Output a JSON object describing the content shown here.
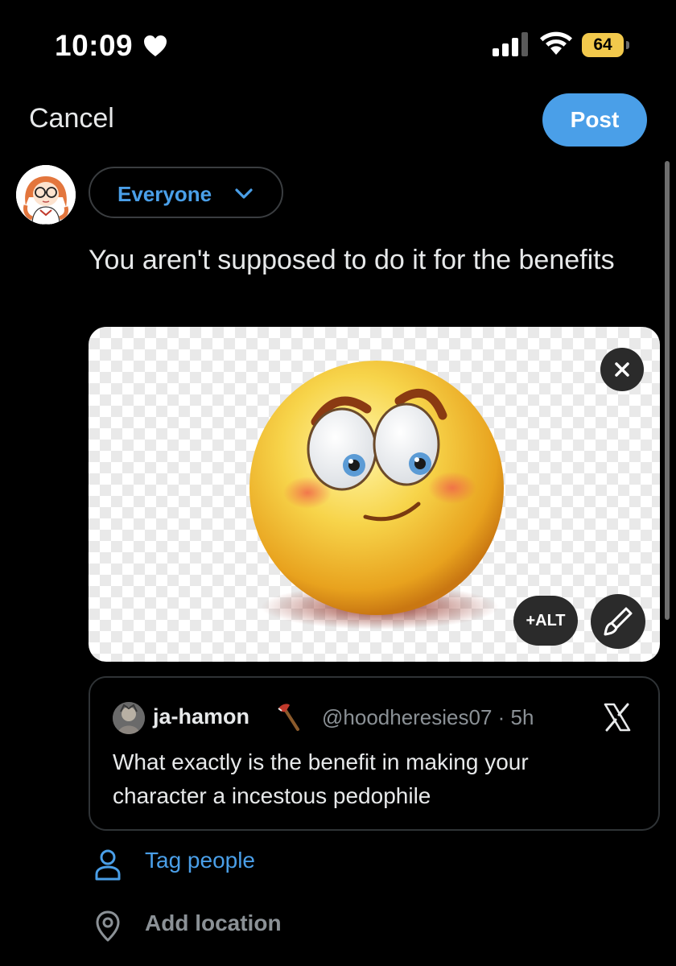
{
  "status_bar": {
    "time": "10:09",
    "battery": "64"
  },
  "header": {
    "cancel_label": "Cancel",
    "post_label": "Post"
  },
  "audience": {
    "label": "Everyone"
  },
  "composer": {
    "text": "You aren't supposed to do it for the benefits"
  },
  "media": {
    "alt_label": "+ALT"
  },
  "quote": {
    "name": "ja-hamon",
    "handle_time": "@hoodheresies07 · 5h",
    "text": "What exactly is the benefit in making your character a incestous pedophile"
  },
  "options": {
    "tag_people": "Tag people",
    "add_location": "Add location"
  },
  "colors": {
    "accent": "#4a9fe8",
    "background": "#000000",
    "muted": "#8b9196",
    "battery": "#f2c94c"
  }
}
